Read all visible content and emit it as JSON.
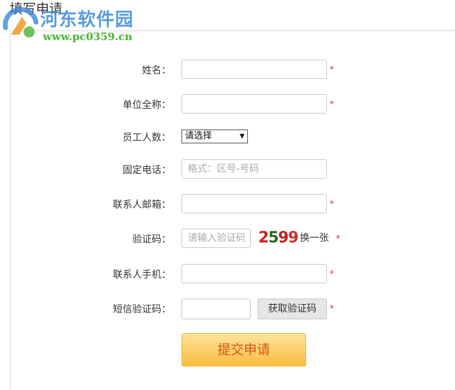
{
  "header": {
    "title": "填写申请"
  },
  "watermark": {
    "name": "河东软件园",
    "url": "www.pc0359.cn"
  },
  "form": {
    "required_mark": "*",
    "name": {
      "label": "姓名：",
      "value": ""
    },
    "company": {
      "label": "单位全称：",
      "value": ""
    },
    "staff_count": {
      "label": "员工人数：",
      "selected": "请选择"
    },
    "phone": {
      "label": "固定电话：",
      "placeholder": "格式：区号-号码"
    },
    "email": {
      "label": "联系人邮箱：",
      "value": ""
    },
    "captcha": {
      "label": "验证码：",
      "placeholder": "请输入验证码",
      "digits": [
        "2",
        "5",
        "9",
        "9"
      ],
      "refresh_label": "换一张"
    },
    "mobile": {
      "label": "联系人手机：",
      "value": ""
    },
    "sms_code": {
      "label": "短信验证码：",
      "value": "",
      "button_label": "获取验证码"
    },
    "submit_label": "提交申请"
  },
  "colors": {
    "required": "#d9262b",
    "submit_text": "#d2551a",
    "submit_bg": "#f9bc3c"
  }
}
